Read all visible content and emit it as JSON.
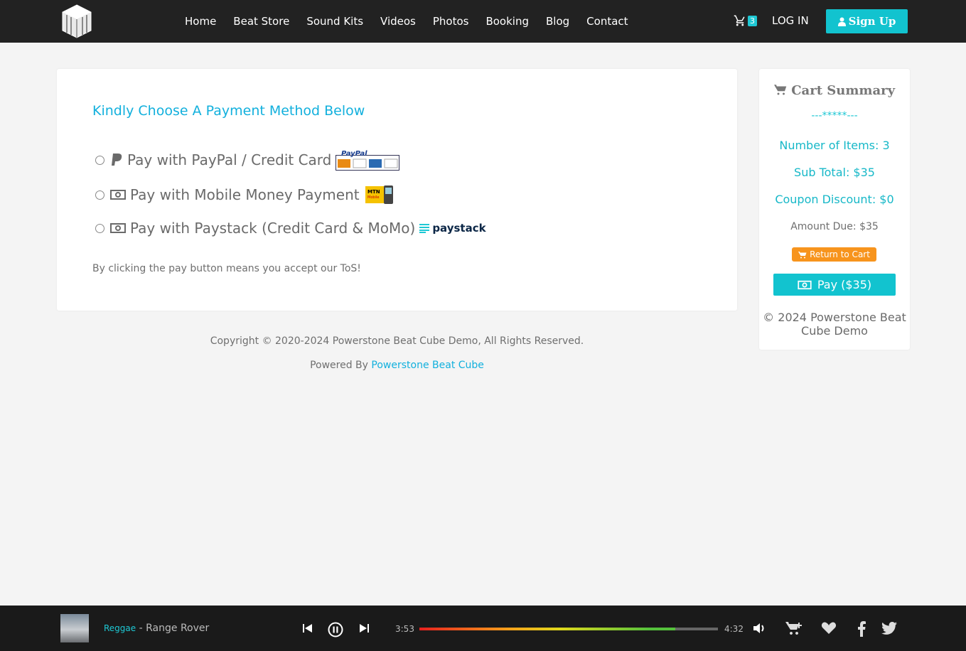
{
  "nav": {
    "items": [
      "Home",
      "Beat Store",
      "Sound Kits",
      "Videos",
      "Photos",
      "Booking",
      "Blog",
      "Contact"
    ],
    "cart_count": "3",
    "login": "LOG IN",
    "signup": "Sign Up"
  },
  "payment": {
    "heading": "Kindly Choose A Payment Method Below",
    "options": [
      {
        "label": "Pay with PayPal / Credit Card",
        "icon": "paypal-icon"
      },
      {
        "label": "Pay with Mobile Money Payment",
        "icon": "money-icon"
      },
      {
        "label": "Pay with Paystack (Credit Card & MoMo)",
        "icon": "money-icon"
      }
    ],
    "paystack_logo": "paystack",
    "tos": "By clicking the pay button means you accept our ToS!"
  },
  "footer": {
    "copyright": "Copyright © 2020-2024 Powerstone Beat Cube Demo, All Rights Reserved.",
    "powered_prefix": "Powered By",
    "powered_link": "Powerstone Beat Cube"
  },
  "summary": {
    "title": "Cart Summary",
    "stars": "---*****---",
    "items": "Number of Items: 3",
    "subtotal": "Sub Total: $35",
    "coupon": "Coupon Discount: $0",
    "due": "Amount Due: $35",
    "return_label": "Return to Cart",
    "pay_label": "Pay ($35)",
    "footer": "© 2024 Powerstone Beat Cube Demo"
  },
  "player": {
    "genre": "Reggae",
    "title": "Range Rover",
    "current_time": "3:53",
    "duration": "4:32",
    "progress": 0.857
  },
  "colors": {
    "accent": "#12c3cf",
    "link": "#12b0dd",
    "orange": "#f7941d",
    "dark": "#222222"
  }
}
